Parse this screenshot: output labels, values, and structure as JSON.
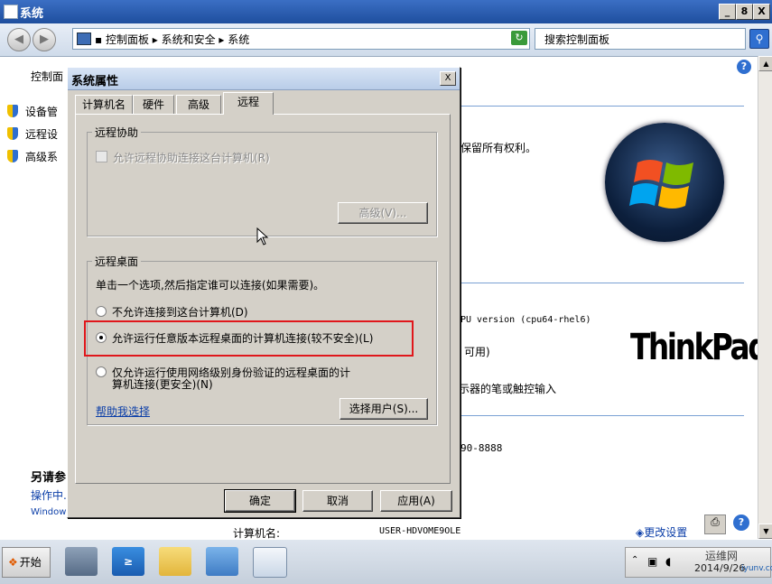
{
  "window": {
    "title": "系统",
    "min_label": "_",
    "max_label": "8",
    "close_label": "X"
  },
  "addressbar": {
    "breadcrumb": "▪ 控制面板 ▸ 系统和安全 ▸ 系统",
    "search_placeholder": "搜索控制面板"
  },
  "background": {
    "sidebar_title": "控制面",
    "sidebar_items": [
      "设备管",
      "远程设",
      "高级系"
    ],
    "see_also": "另请参",
    "action_center": "操作中.",
    "windows_update": "Window",
    "copyright_text": "保留所有权利。",
    "processor_text": "PU version (cpu64-rhel6)",
    "memory_text": "可用)",
    "pen_text": "示器的笔或触控输入",
    "phone_text": "90-8888",
    "computer_name_label": "计算机名:",
    "computer_name_value": "USER-HDVOME9OLE",
    "change_settings": "更改设置",
    "thinkpad_logo": "ThinkPad"
  },
  "dialog": {
    "title": "系统属性",
    "close_label": "X",
    "tabs": [
      "计算机名",
      "硬件",
      "高级",
      "远程"
    ],
    "assist_group": "远程协助",
    "assist_checkbox": "允许远程协助连接这台计算机(R)",
    "assist_advanced": "高级(V)...",
    "desktop_group": "远程桌面",
    "desktop_hint": "单击一个选项,然后指定谁可以连接(如果需要)。",
    "option_1": "不允许连接到这台计算机(D)",
    "option_2": "允许运行任意版本远程桌面的计算机连接(较不安全)(L)",
    "option_3_line1": "仅允许运行使用网络级别身份验证的远程桌面的计",
    "option_3_line2": "算机连接(更安全)(N)",
    "help_link": "帮助我选择",
    "select_users": "选择用户(S)...",
    "ok": "确定",
    "cancel": "取消",
    "apply": "应用(A)"
  },
  "taskbar": {
    "start": "开始",
    "watermark": "运维网",
    "date": "2014/9/26",
    "watermark_url": "iyunv.com"
  }
}
